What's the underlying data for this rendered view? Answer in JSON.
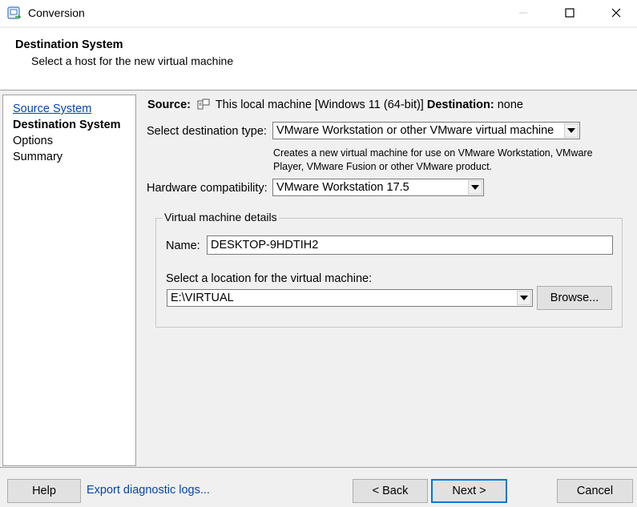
{
  "window": {
    "title": "Conversion",
    "icon": "vmware-converter-icon",
    "controls": [
      "minimize-icon",
      "maximize-icon",
      "close-icon"
    ]
  },
  "header": {
    "title": "Destination System",
    "subtitle": "Select a host for the new virtual machine"
  },
  "nav": {
    "items": [
      {
        "label": "Source System",
        "state": "link"
      },
      {
        "label": "Destination System",
        "state": "active"
      },
      {
        "label": "Options",
        "state": "normal"
      },
      {
        "label": "Summary",
        "state": "normal"
      }
    ]
  },
  "summary_line": {
    "source_label": "Source:",
    "source_icon": "computer-icon",
    "source_value": "This local machine [Windows 11 (64-bit)]",
    "destination_label": "Destination:",
    "destination_value": "none"
  },
  "destination_type": {
    "label": "Select destination type:",
    "value": "VMware Workstation or other VMware virtual machine",
    "description_line1": "Creates a new virtual machine for use on VMware Workstation, VMware",
    "description_line2": "Player, VMware Fusion or other VMware product."
  },
  "hardware": {
    "label": "Hardware compatibility:",
    "value": "VMware Workstation 17.5"
  },
  "vm_details": {
    "legend": "Virtual machine details",
    "name_label": "Name:",
    "name_value": "DESKTOP-9HDTIH2",
    "location_label": "Select a location for the virtual machine:",
    "location_value": "E:\\VIRTUAL",
    "browse_label": "Browse..."
  },
  "footer": {
    "help_label": "Help",
    "export_label": "Export diagnostic logs...",
    "back_label": "< Back",
    "next_label": "Next >",
    "cancel_label": "Cancel"
  },
  "colors": {
    "link": "#0645ad",
    "focus": "#0078d7",
    "background": "#f0f0f0"
  }
}
